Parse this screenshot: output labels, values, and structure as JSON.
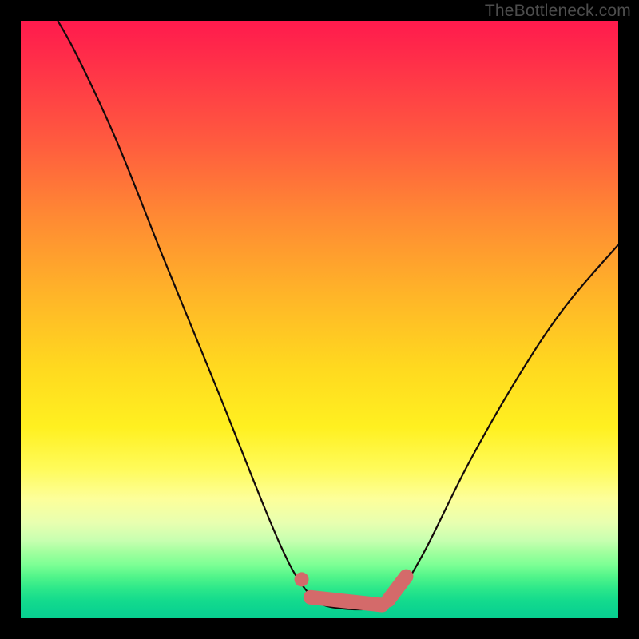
{
  "watermark": "TheBottleneck.com",
  "colors": {
    "curve_stroke": "#140a0a",
    "marker_stroke": "#d46a6a",
    "background": "#000000"
  },
  "chart_data": {
    "type": "line",
    "title": "",
    "xlabel": "",
    "ylabel": "",
    "xlim": [
      0,
      100
    ],
    "ylim": [
      0,
      100
    ],
    "note": "Axes carry no labels or ticks in the image. x/y below are percent of plot width/height with (0,0) at top-left, matching the image coordinate frame.",
    "series": [
      {
        "name": "left-arm",
        "type": "line",
        "points": [
          {
            "x": 6.2,
            "y": 0.0
          },
          {
            "x": 9.5,
            "y": 6.0
          },
          {
            "x": 16.0,
            "y": 20.0
          },
          {
            "x": 24.0,
            "y": 40.0
          },
          {
            "x": 33.0,
            "y": 62.0
          },
          {
            "x": 41.0,
            "y": 82.0
          },
          {
            "x": 45.0,
            "y": 91.0
          },
          {
            "x": 47.5,
            "y": 95.0
          }
        ]
      },
      {
        "name": "trough",
        "type": "line",
        "points": [
          {
            "x": 47.5,
            "y": 95.0
          },
          {
            "x": 50.0,
            "y": 97.5
          },
          {
            "x": 54.0,
            "y": 98.4
          },
          {
            "x": 58.5,
            "y": 98.4
          },
          {
            "x": 62.0,
            "y": 97.2
          },
          {
            "x": 64.0,
            "y": 95.0
          }
        ]
      },
      {
        "name": "right-arm",
        "type": "line",
        "points": [
          {
            "x": 64.0,
            "y": 95.0
          },
          {
            "x": 68.0,
            "y": 88.0
          },
          {
            "x": 75.0,
            "y": 74.0
          },
          {
            "x": 83.0,
            "y": 60.0
          },
          {
            "x": 91.0,
            "y": 48.0
          },
          {
            "x": 100.0,
            "y": 37.5
          }
        ]
      }
    ],
    "annotations": [
      {
        "name": "trough-marker-left",
        "type": "dot",
        "x": 47.0,
        "y": 93.5
      },
      {
        "name": "trough-marker-band",
        "type": "smear",
        "points": [
          {
            "x": 48.5,
            "y": 96.5
          },
          {
            "x": 60.5,
            "y": 97.8
          }
        ]
      },
      {
        "name": "trough-marker-right",
        "type": "smear",
        "points": [
          {
            "x": 61.5,
            "y": 97.0
          },
          {
            "x": 64.5,
            "y": 93.0
          }
        ]
      }
    ]
  }
}
